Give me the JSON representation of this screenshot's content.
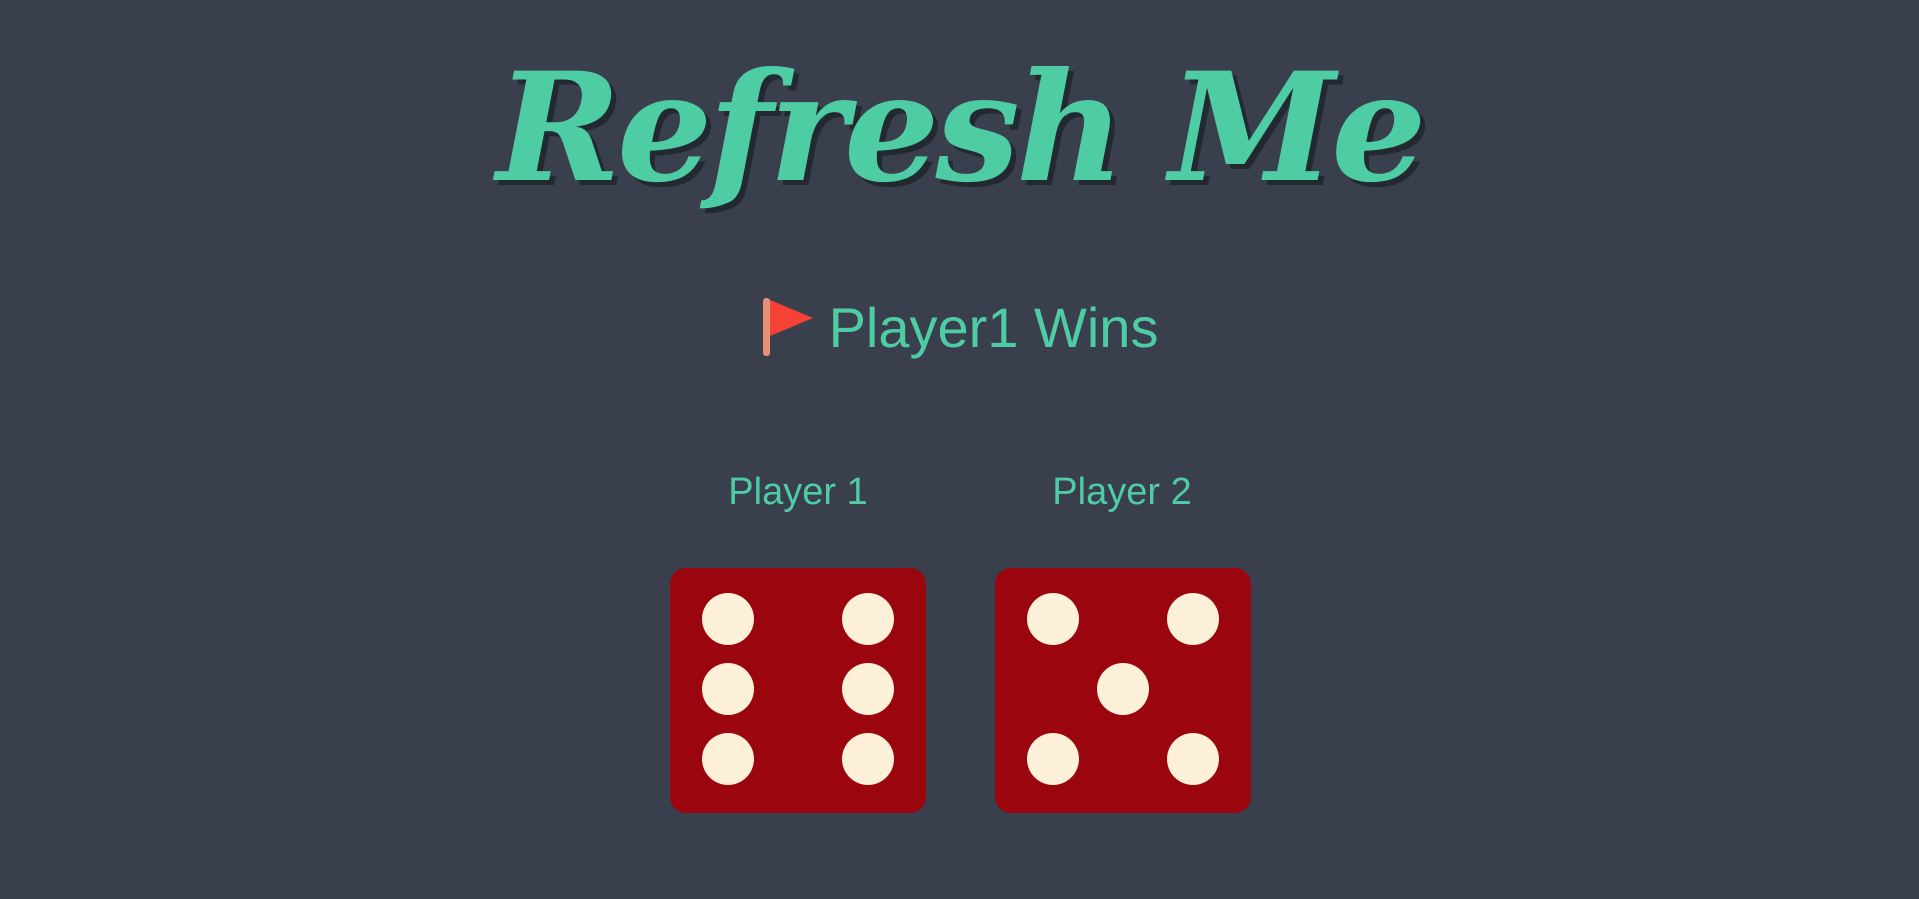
{
  "app": {
    "title": "Refresh Me"
  },
  "result": {
    "icon": "flag-icon",
    "text": "Player1 Wins"
  },
  "players": [
    {
      "label": "Player 1",
      "die_value": 6
    },
    {
      "label": "Player 2",
      "die_value": 5
    }
  ],
  "colors": {
    "background": "#393F4D",
    "accent": "#4ECCA3",
    "die": "#9B050E",
    "pip": "#FCF0D8",
    "flag": "#F44336"
  }
}
